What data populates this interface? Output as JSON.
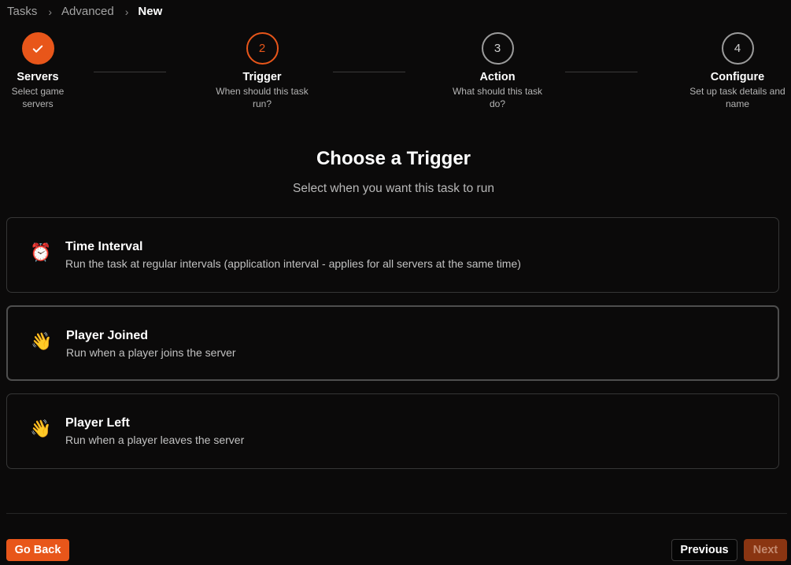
{
  "breadcrumb": {
    "items": [
      "Tasks",
      "Advanced",
      "New"
    ],
    "separator": "›"
  },
  "stepper": {
    "steps": [
      {
        "marker": "✓",
        "title": "Servers",
        "desc": "Select game servers",
        "state": "done"
      },
      {
        "marker": "2",
        "title": "Trigger",
        "desc": "When should this task run?",
        "state": "active"
      },
      {
        "marker": "3",
        "title": "Action",
        "desc": "What should this task do?",
        "state": "pending"
      },
      {
        "marker": "4",
        "title": "Configure",
        "desc": "Set up task details and name",
        "state": "pending"
      }
    ]
  },
  "main": {
    "heading": "Choose a Trigger",
    "subheading": "Select when you want this task to run"
  },
  "triggers": [
    {
      "emoji": "⏰",
      "icon": "alarm-clock-icon",
      "title": "Time Interval",
      "desc": "Run the task at regular intervals (application interval - applies for all servers at the same time)"
    },
    {
      "emoji": "👋",
      "icon": "waving-hand-icon",
      "title": "Player Joined",
      "desc": "Run when a player joins the server"
    },
    {
      "emoji": "👋",
      "icon": "waving-hand-icon",
      "title": "Player Left",
      "desc": "Run when a player leaves the server"
    }
  ],
  "footer": {
    "back_label": "Go Back",
    "previous_label": "Previous",
    "next_label": "Next"
  },
  "colors": {
    "accent": "#e8561a",
    "background": "#0b0a0a",
    "next_disabled": "#8a3512"
  }
}
